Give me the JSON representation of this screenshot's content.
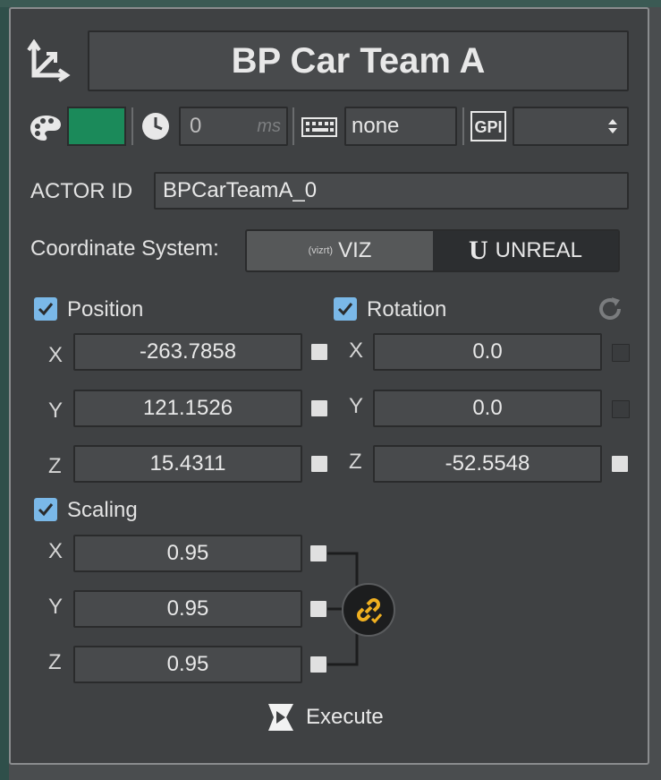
{
  "header": {
    "title": "BP Car Team A",
    "icon": "transform-axes-icon"
  },
  "toolbar": {
    "color_swatch": "#1b8a5a",
    "palette_icon": "palette-icon",
    "clock_icon": "clock-icon",
    "delay_value": "0",
    "delay_unit": "ms",
    "keyboard_icon": "keyboard-icon",
    "key_value": "none",
    "gpi_icon": "gpi-icon",
    "gpi_value": ""
  },
  "actor": {
    "label": "ACTOR ID",
    "value": "BPCarTeamA_0"
  },
  "coordinate": {
    "label": "Coordinate System:",
    "viz_prefix": "(vizrt)",
    "viz_label": "VIZ",
    "unreal_label": "UNREAL"
  },
  "position": {
    "label": "Position",
    "checked": true,
    "x_label": "X",
    "y_label": "Y",
    "z_label": "Z",
    "x": "-263.7858",
    "y": "121.1526",
    "z": "15.4311"
  },
  "rotation": {
    "label": "Rotation",
    "checked": true,
    "x_label": "X",
    "y_label": "Y",
    "z_label": "Z",
    "x": "0.0",
    "y": "0.0",
    "z": "-52.5548"
  },
  "scaling": {
    "label": "Scaling",
    "checked": true,
    "x_label": "X",
    "y_label": "Y",
    "z_label": "Z",
    "x": "0.95",
    "y": "0.95",
    "z": "0.95"
  },
  "execute": {
    "label": "Execute"
  }
}
